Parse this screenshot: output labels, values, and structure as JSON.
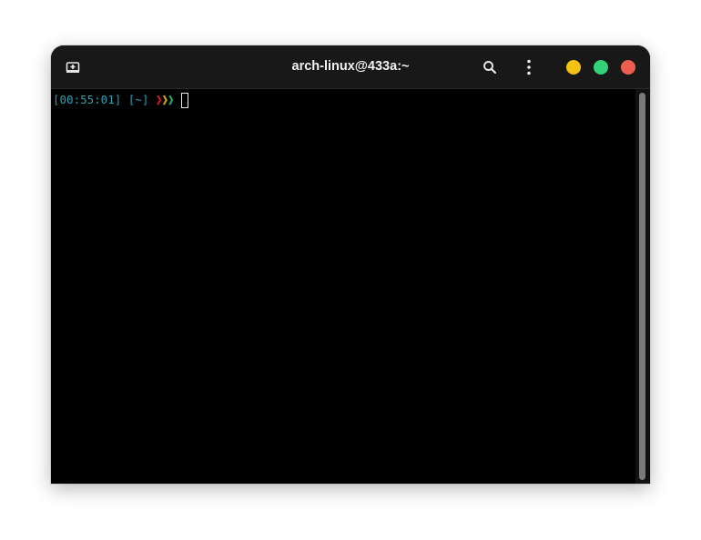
{
  "window": {
    "title": "arch-linux@433a:~"
  },
  "headerbar": {
    "new_tab_icon": "tab-new-icon",
    "search_icon": "search-icon",
    "menu_icon": "kebab-menu-icon",
    "buttons": {
      "minimize_color": "#f5c211",
      "maximize_color": "#33d17a",
      "close_color": "#ed5e50"
    }
  },
  "terminal": {
    "prompt": {
      "time": "[00:55:01]",
      "dir": "[~]",
      "chevrons": [
        "❱",
        "❱",
        "❱"
      ],
      "chevron_colors": [
        "#c01c28",
        "#c4a000",
        "#26a269"
      ]
    },
    "text_color": "#2aa1b3",
    "background": "#000000"
  }
}
